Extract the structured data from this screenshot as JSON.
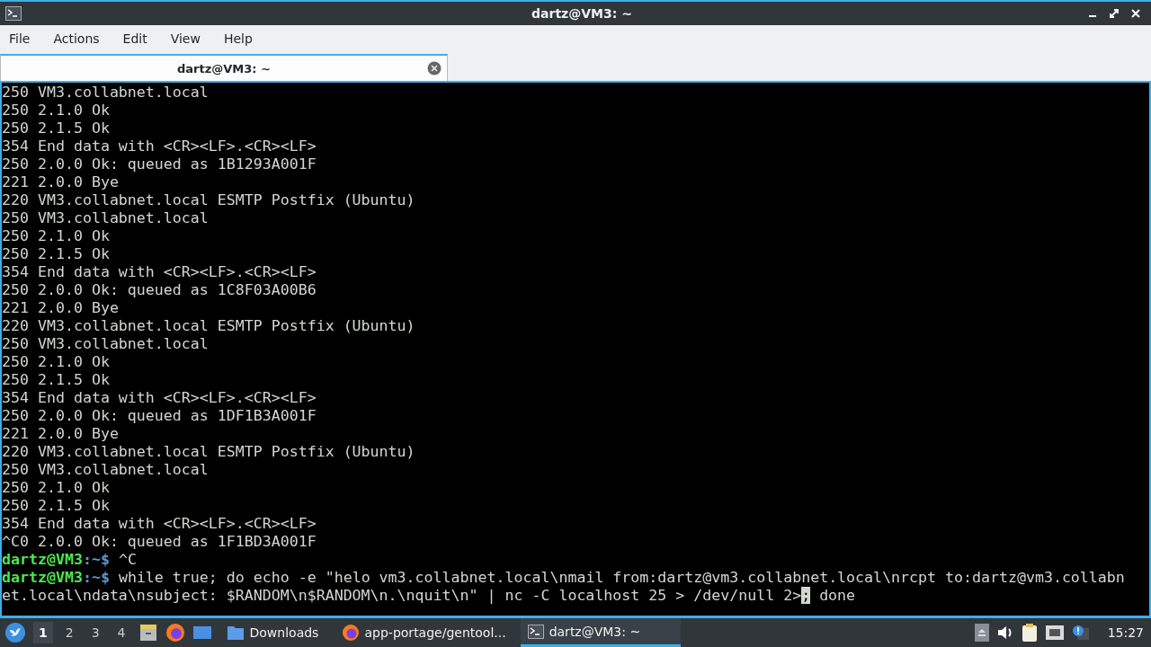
{
  "window": {
    "title": "dartz@VM3: ~"
  },
  "menu": [
    "File",
    "Actions",
    "Edit",
    "View",
    "Help"
  ],
  "tabs": [
    {
      "label": "dartz@VM3: ~",
      "selected": true
    }
  ],
  "terminal": {
    "lines": [
      {
        "kind": "output",
        "text": "250 VM3.collabnet.local"
      },
      {
        "kind": "output",
        "text": "250 2.1.0 Ok"
      },
      {
        "kind": "output",
        "text": "250 2.1.5 Ok"
      },
      {
        "kind": "output",
        "text": "354 End data with <CR><LF>.<CR><LF>"
      },
      {
        "kind": "output",
        "text": "250 2.0.0 Ok: queued as 1B1293A001F"
      },
      {
        "kind": "output",
        "text": "221 2.0.0 Bye"
      },
      {
        "kind": "output",
        "text": "220 VM3.collabnet.local ESMTP Postfix (Ubuntu)"
      },
      {
        "kind": "output",
        "text": "250 VM3.collabnet.local"
      },
      {
        "kind": "output",
        "text": "250 2.1.0 Ok"
      },
      {
        "kind": "output",
        "text": "250 2.1.5 Ok"
      },
      {
        "kind": "output",
        "text": "354 End data with <CR><LF>.<CR><LF>"
      },
      {
        "kind": "output",
        "text": "250 2.0.0 Ok: queued as 1C8F03A00B6"
      },
      {
        "kind": "output",
        "text": "221 2.0.0 Bye"
      },
      {
        "kind": "output",
        "text": "220 VM3.collabnet.local ESMTP Postfix (Ubuntu)"
      },
      {
        "kind": "output",
        "text": "250 VM3.collabnet.local"
      },
      {
        "kind": "output",
        "text": "250 2.1.0 Ok"
      },
      {
        "kind": "output",
        "text": "250 2.1.5 Ok"
      },
      {
        "kind": "output",
        "text": "354 End data with <CR><LF>.<CR><LF>"
      },
      {
        "kind": "output",
        "text": "250 2.0.0 Ok: queued as 1DF1B3A001F"
      },
      {
        "kind": "output",
        "text": "221 2.0.0 Bye"
      },
      {
        "kind": "output",
        "text": "220 VM3.collabnet.local ESMTP Postfix (Ubuntu)"
      },
      {
        "kind": "output",
        "text": "250 VM3.collabnet.local"
      },
      {
        "kind": "output",
        "text": "250 2.1.0 Ok"
      },
      {
        "kind": "output",
        "text": "250 2.1.5 Ok"
      },
      {
        "kind": "output",
        "text": "354 End data with <CR><LF>.<CR><LF>"
      },
      {
        "kind": "output",
        "text": "^C0 2.0.0 Ok: queued as 1F1BD3A001F"
      },
      {
        "kind": "prompt",
        "user": "dartz@VM3",
        "path": ":~$",
        "command": "^C"
      },
      {
        "kind": "prompt",
        "user": "dartz@VM3",
        "path": ":~$",
        "command": "while true; do echo -e \"helo vm3.collabnet.local\\nmail from:dartz@vm3.collabnet.local\\nrcpt to:dartz@vm3.collabn"
      },
      {
        "kind": "cursor",
        "before": "et.local\\ndata\\nsubject: $RANDOM\\n$RANDOM\\n.\\nquit\\n\" | nc -C localhost 25 > /dev/null 2>",
        "cursor": ";",
        "after": " done"
      }
    ]
  },
  "taskbar": {
    "workspaces": [
      {
        "label": "1",
        "selected": true
      },
      {
        "label": "2",
        "selected": false
      },
      {
        "label": "3",
        "selected": false
      },
      {
        "label": "4",
        "selected": false
      }
    ],
    "tasks": [
      {
        "kind": "folder",
        "label": "Downloads",
        "selected": false
      },
      {
        "kind": "browser",
        "label": "app-portage/gentool...",
        "selected": false
      },
      {
        "kind": "terminal",
        "label": "dartz@VM3: ~",
        "selected": true
      }
    ],
    "clock": "15:27"
  }
}
